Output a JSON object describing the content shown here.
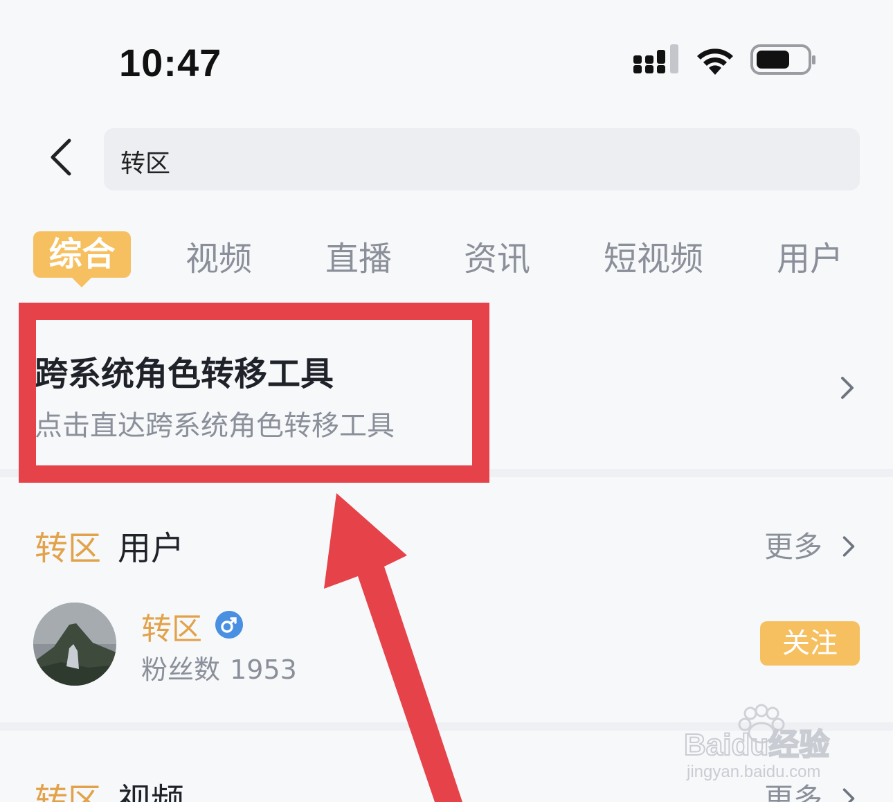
{
  "status_bar": {
    "time": "10:47"
  },
  "search": {
    "query": "转区"
  },
  "tabs": [
    {
      "label": "综合"
    },
    {
      "label": "视频"
    },
    {
      "label": "直播"
    },
    {
      "label": "资讯"
    },
    {
      "label": "短视频"
    },
    {
      "label": "用户"
    }
  ],
  "tool_card": {
    "title": "跨系统角色转移工具",
    "subtitle": "点击直达跨系统角色转移工具"
  },
  "user_section": {
    "keyword": "转区",
    "label": "用户",
    "more": "更多",
    "user": {
      "name": "转区",
      "gender": "male",
      "fans_label": "粉丝数",
      "fans_count": "1953",
      "follow_label": "关注"
    }
  },
  "video_section": {
    "keyword": "转区",
    "label": "视频",
    "more": "更多"
  },
  "colors": {
    "accent": "#f6c061",
    "keyword": "#e2a24a",
    "highlight": "#e5424a",
    "muted": "#8a8f99"
  },
  "icons": [
    "cellular-signal-icon",
    "wifi-icon",
    "battery-icon",
    "back-arrow-icon",
    "chevron-right-icon",
    "male-gender-icon"
  ],
  "watermark": {
    "brand": "Baidu经验",
    "url": "jingyan.baidu.com"
  }
}
